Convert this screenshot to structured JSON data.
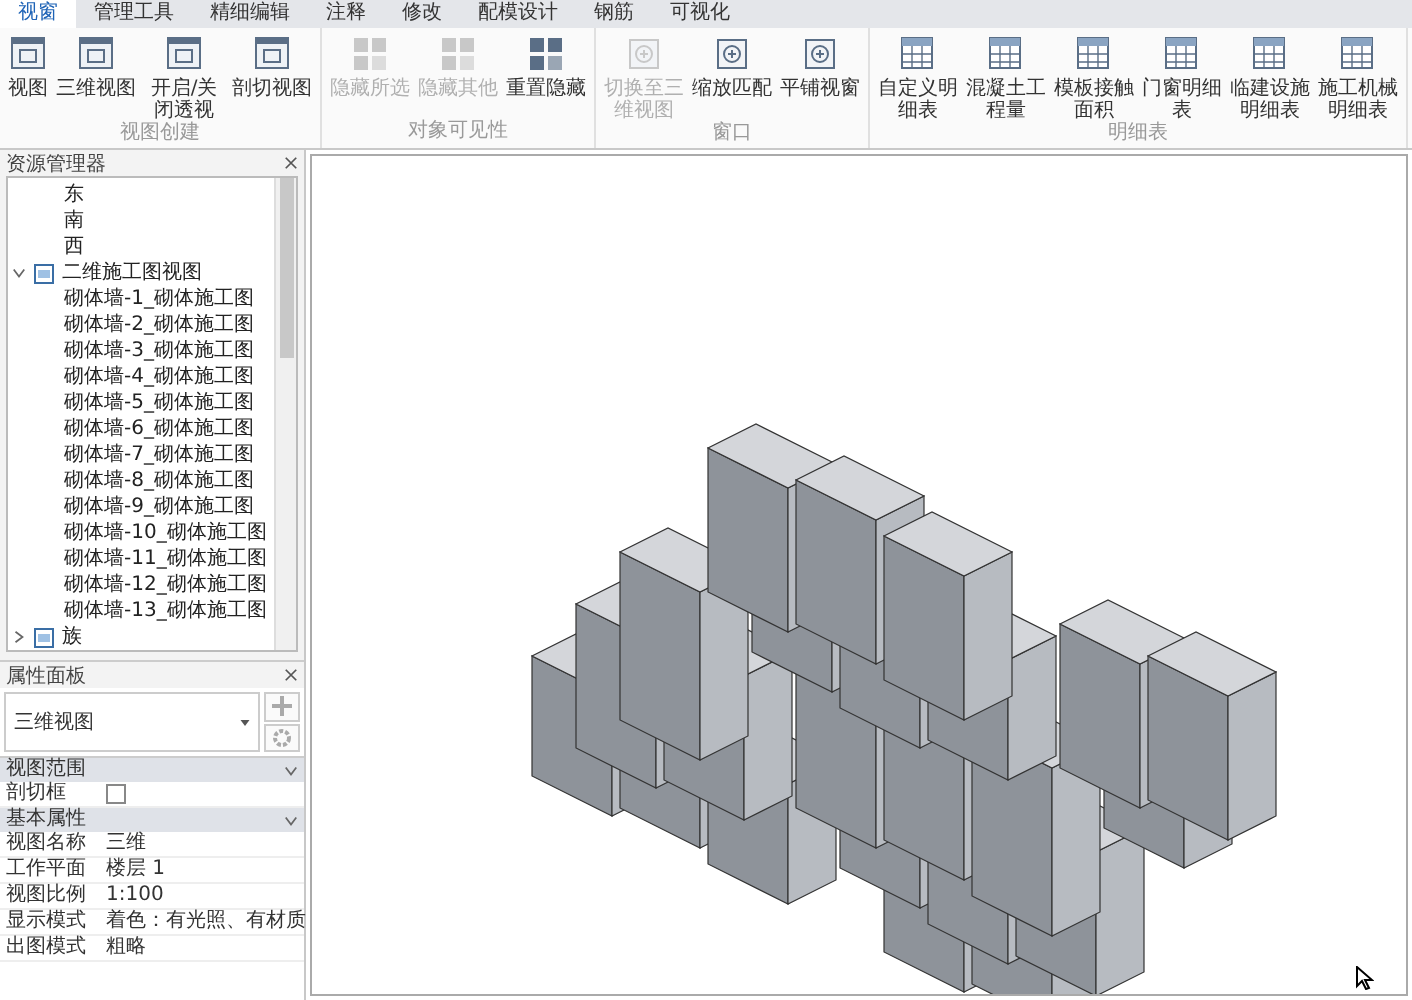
{
  "tabs": [
    {
      "label": "视窗",
      "selected": true
    },
    {
      "label": "管理工具",
      "selected": false
    },
    {
      "label": "精细编辑",
      "selected": false
    },
    {
      "label": "注释",
      "selected": false
    },
    {
      "label": "修改",
      "selected": false
    },
    {
      "label": "配模设计",
      "selected": false
    },
    {
      "label": "钢筋",
      "selected": false
    },
    {
      "label": "可视化",
      "selected": false
    }
  ],
  "ribbon": {
    "groups": [
      {
        "title": "视图创建",
        "buttons": [
          {
            "label": "视图",
            "disabled": false
          },
          {
            "label": "三维视图",
            "disabled": false
          },
          {
            "label": "开启/关闭透视",
            "disabled": false
          },
          {
            "label": "剖切视图",
            "disabled": false
          }
        ]
      },
      {
        "title": "对象可见性",
        "buttons": [
          {
            "label": "隐藏所选",
            "disabled": true
          },
          {
            "label": "隐藏其他",
            "disabled": true
          },
          {
            "label": "重置隐藏",
            "disabled": false
          }
        ]
      },
      {
        "title": "窗口",
        "buttons": [
          {
            "label": "切换至三维视图",
            "disabled": true
          },
          {
            "label": "缩放匹配",
            "disabled": false
          },
          {
            "label": "平铺视窗",
            "disabled": false
          }
        ]
      },
      {
        "title": "明细表",
        "buttons": [
          {
            "label": "自定义明细表",
            "disabled": false
          },
          {
            "label": "混凝土工程量",
            "disabled": false
          },
          {
            "label": "模板接触面积",
            "disabled": false
          },
          {
            "label": "门窗明细表",
            "disabled": false
          },
          {
            "label": "临建设施明细表",
            "disabled": false
          },
          {
            "label": "施工机械明细表",
            "disabled": false
          }
        ]
      }
    ]
  },
  "explorer": {
    "title": "资源管理器",
    "tree": [
      {
        "label": "东"
      },
      {
        "label": "南"
      },
      {
        "label": "西"
      },
      {
        "label": "二维施工图视图",
        "expanded": true,
        "children": [
          {
            "label": "砌体墙-1_砌体施工图"
          },
          {
            "label": "砌体墙-2_砌体施工图"
          },
          {
            "label": "砌体墙-3_砌体施工图"
          },
          {
            "label": "砌体墙-4_砌体施工图"
          },
          {
            "label": "砌体墙-5_砌体施工图"
          },
          {
            "label": "砌体墙-6_砌体施工图"
          },
          {
            "label": "砌体墙-7_砌体施工图"
          },
          {
            "label": "砌体墙-8_砌体施工图"
          },
          {
            "label": "砌体墙-9_砌体施工图"
          },
          {
            "label": "砌体墙-10_砌体施工图"
          },
          {
            "label": "砌体墙-11_砌体施工图"
          },
          {
            "label": "砌体墙-12_砌体施工图"
          },
          {
            "label": "砌体墙-13_砌体施工图"
          }
        ]
      },
      {
        "label": "族",
        "expanded": false
      }
    ]
  },
  "properties": {
    "title": "属性面板",
    "type": "三维视图",
    "sections": [
      {
        "title": "视图范围",
        "expanded": true,
        "rows": [
          {
            "kind": "checkbox",
            "label": "剖切框",
            "checked": false
          }
        ]
      },
      {
        "title": "基本属性",
        "expanded": true,
        "rows": [
          {
            "kind": "text",
            "label": "视图名称",
            "value": "三维"
          },
          {
            "kind": "text",
            "label": "工作平面",
            "value": "楼层 1"
          },
          {
            "kind": "text",
            "label": "视图比例",
            "value": "1:100"
          },
          {
            "kind": "text",
            "label": "显示模式",
            "value": "着色：有光照、有材质"
          },
          {
            "kind": "text",
            "label": "出图模式",
            "value": "粗略"
          }
        ]
      }
    ]
  }
}
